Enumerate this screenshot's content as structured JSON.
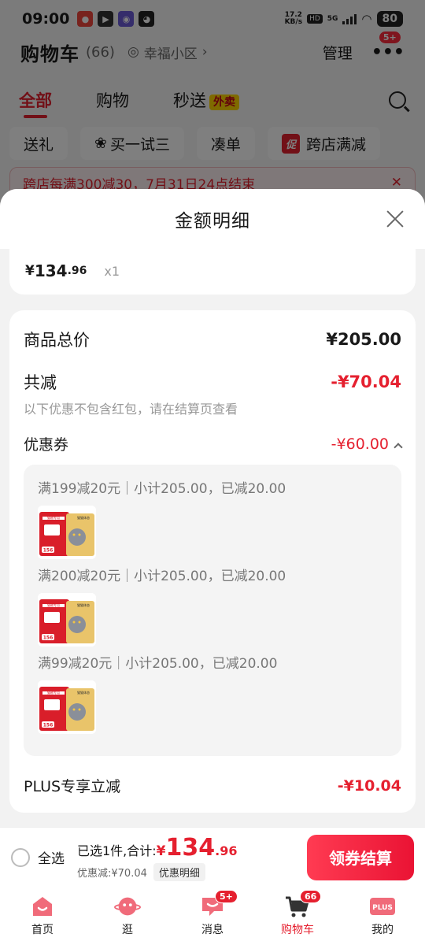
{
  "status_bar": {
    "time": "09:00",
    "net_speed": "17.2",
    "net_unit": "KB/s",
    "hd": "HD",
    "gen": "5G",
    "battery": "80"
  },
  "header": {
    "title": "购物车",
    "count": "(66)",
    "location": "幸福小区",
    "manage": "管理",
    "more_badge": "5+"
  },
  "tabs": [
    {
      "label": "全部",
      "active": true
    },
    {
      "label": "购物",
      "active": false
    },
    {
      "label": "秒送",
      "active": false,
      "tag": "外卖"
    }
  ],
  "chips": [
    {
      "label": "送礼"
    },
    {
      "label": "买一试三"
    },
    {
      "label": "凑单"
    },
    {
      "label": "跨店满减",
      "promo": "促"
    }
  ],
  "notice": {
    "text": "跨店每满300减30，7月31日24点结束"
  },
  "sheet": {
    "title": "金额明细",
    "item": {
      "currency": "¥",
      "price_int": "134",
      "price_dec": ".96",
      "qty": "x1"
    },
    "total_label": "商品总价",
    "total_value": "¥205.00",
    "discount_label": "共减",
    "discount_value": "-¥70.04",
    "discount_note": "以下优惠不包含红包，请在结算页查看",
    "coupon_label": "优惠券",
    "coupon_value": "-¥60.00",
    "coupons": [
      {
        "text": "满199减20元｜小计205.00，已减20.00"
      },
      {
        "text": "满200减20元｜小计205.00，已减20.00"
      },
      {
        "text": "满99减20元｜小计205.00，已减20.00"
      }
    ],
    "product_thumb": {
      "banner": "猫粮专用",
      "subtitle": "猫猫体态",
      "tag": "156"
    },
    "plus_label": "PLUS专享立减",
    "plus_value": "-¥10.04"
  },
  "checkout": {
    "select_all": "全选",
    "selected_prefix": "已选1件,合计:",
    "currency": "¥",
    "total_int": "134",
    "total_dec": ".96",
    "discount_text": "优惠减:¥70.04",
    "detail_link": "优惠明细",
    "button": "领券结算"
  },
  "tabbar": [
    {
      "label": "首页",
      "icon": "home-icon"
    },
    {
      "label": "逛",
      "icon": "explore-icon"
    },
    {
      "label": "消息",
      "icon": "message-icon",
      "badge": "5+"
    },
    {
      "label": "购物车",
      "icon": "cart-icon",
      "badge": "66",
      "active": true
    },
    {
      "label": "我的",
      "icon": "plus-icon",
      "icon_text": "PLUS"
    }
  ],
  "colors": {
    "accent": "#e5202f",
    "overlay": "rgba(0,0,0,0.5)"
  }
}
